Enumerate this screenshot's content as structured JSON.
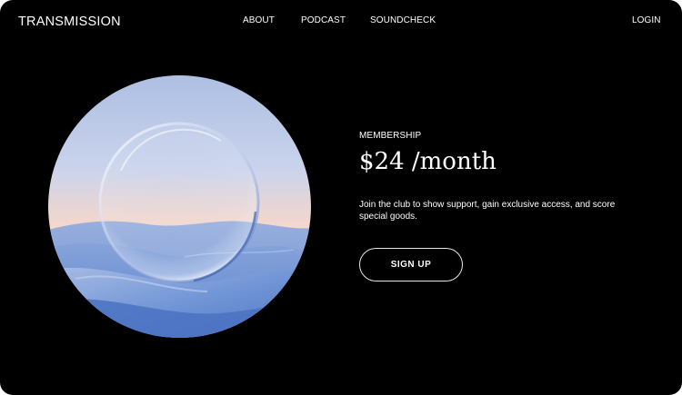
{
  "header": {
    "logo": "TRANSMISSION",
    "nav": {
      "about": "ABOUT",
      "podcast": "PODCAST",
      "soundcheck": "SOUNDCHECK"
    },
    "login": "LOGIN"
  },
  "hero": {
    "image": "glass-sphere-over-blue-dunes",
    "label": "MEMBERSHIP",
    "price": "$24 /month",
    "description": "Join the club to show support, gain exclusive access, and score special goods.",
    "cta": "SIGN UP"
  },
  "colors": {
    "background": "#000000",
    "text": "#ffffff",
    "button_border": "#e6e6e6",
    "sky_top": "#b9cbe8",
    "horizon_glow": "#f3d2c6",
    "dune_blue": "#5f86cf"
  }
}
